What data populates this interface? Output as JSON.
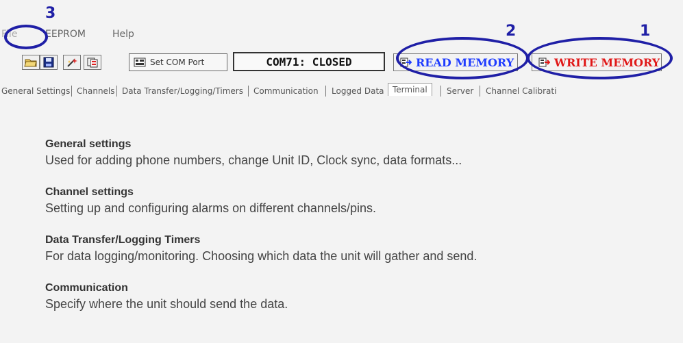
{
  "annotations": {
    "file_marker": "3",
    "read_marker": "2",
    "write_marker": "1",
    "marker_color": "#1f1fa6"
  },
  "menu": {
    "file": "File",
    "eeprom": "EEPROM",
    "help": "Help"
  },
  "toolbar": {
    "open_icon": "folder-open-icon",
    "save_icon": "save-disk-icon",
    "wizard_icon": "wand-icon",
    "copy_icon": "copy-icon",
    "set_com_port": "Set COM Port",
    "com_status": "COM71: CLOSED",
    "read_memory": "READ MEMORY",
    "write_memory": "WRITE MEMORY",
    "read_color": "#1f3cff",
    "write_color": "#e01818"
  },
  "tabs": [
    "General Settings",
    "Channels",
    "Data Transfer/Logging/Timers",
    "Communication",
    "Logged Data",
    "Terminal",
    "Server",
    "Channel Calibrati"
  ],
  "sections": [
    {
      "title": "General settings",
      "desc": "Used for adding phone numbers, change Unit ID, Clock sync, data formats..."
    },
    {
      "title": "Channel settings",
      "desc": "Setting up and configuring alarms on different channels/pins."
    },
    {
      "title": "Data Transfer/Logging Timers",
      "desc": "For data logging/monitoring. Choosing which data the unit will gather and send."
    },
    {
      "title": "Communication",
      "desc": "Specify where the unit should send the data."
    }
  ]
}
